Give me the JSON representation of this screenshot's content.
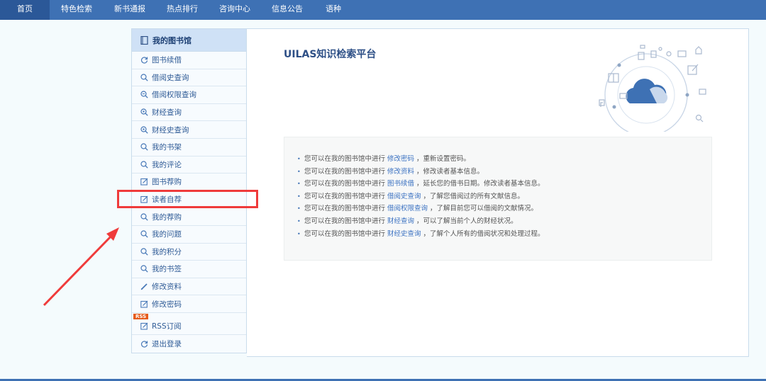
{
  "nav": {
    "items": [
      {
        "label": "首页",
        "active": true
      },
      {
        "label": "特色检索"
      },
      {
        "label": "新书通报"
      },
      {
        "label": "热点排行"
      },
      {
        "label": "咨询中心"
      },
      {
        "label": "信息公告"
      },
      {
        "label": "语种"
      }
    ]
  },
  "sidebar": {
    "title": "我的图书馆",
    "items": [
      {
        "label": "图书续借",
        "icon": "refresh-icon"
      },
      {
        "label": "借阅史查询",
        "icon": "search-icon"
      },
      {
        "label": "借阅权限查询",
        "icon": "search-plus-icon"
      },
      {
        "label": "财经查询",
        "icon": "search-dot-icon"
      },
      {
        "label": "财经史查询",
        "icon": "search-dot-icon"
      },
      {
        "label": "我的书架",
        "icon": "search-icon"
      },
      {
        "label": "我的评论",
        "icon": "search-icon"
      },
      {
        "label": "图书荐购",
        "icon": "edit-icon"
      },
      {
        "label": "读者自荐",
        "icon": "edit-icon"
      },
      {
        "label": "我的荐购",
        "icon": "search-icon"
      },
      {
        "label": "我的问题",
        "icon": "search-icon"
      },
      {
        "label": "我的积分",
        "icon": "search-icon"
      },
      {
        "label": "我的书签",
        "icon": "search-icon"
      },
      {
        "label": "修改资料",
        "icon": "pencil-icon"
      },
      {
        "label": "修改密码",
        "icon": "edit-icon"
      },
      {
        "label": "RSS订阅",
        "icon": "edit-icon",
        "badge": "RSS"
      },
      {
        "label": "退出登录",
        "icon": "refresh-icon"
      }
    ]
  },
  "main": {
    "title": "UILAS知识检索平台",
    "notices": [
      {
        "prefix": "您可以在我的图书馆中进行",
        "link": "修改密码",
        "suffix": "，重新设置密码。"
      },
      {
        "prefix": "您可以在我的图书馆中进行",
        "link": "修改资料",
        "suffix": "，修改读者基本信息。"
      },
      {
        "prefix": "您可以在我的图书馆中进行",
        "link": "图书续借",
        "suffix": "，延长您的借书日期。修改读者基本信息。"
      },
      {
        "prefix": "您可以在我的图书馆中进行",
        "link": "借阅史查询",
        "suffix": "，了解您借阅过的所有文献信息。"
      },
      {
        "prefix": "您可以在我的图书馆中进行",
        "link": "借阅权限查询",
        "suffix": "，了解目前您可以借阅的文献情况。"
      },
      {
        "prefix": "您可以在我的图书馆中进行",
        "link": "财经查询",
        "suffix": "，可以了解当前个人的财经状况。"
      },
      {
        "prefix": "您可以在我的图书馆中进行",
        "link": "财经史查询",
        "suffix": "，了解个人所有的借阅状况和处理过程。"
      }
    ]
  },
  "colors": {
    "nav": "#3e71b4",
    "accent": "#2d4f86",
    "link": "#3d73c2",
    "highlight": "#ef3b3b"
  }
}
